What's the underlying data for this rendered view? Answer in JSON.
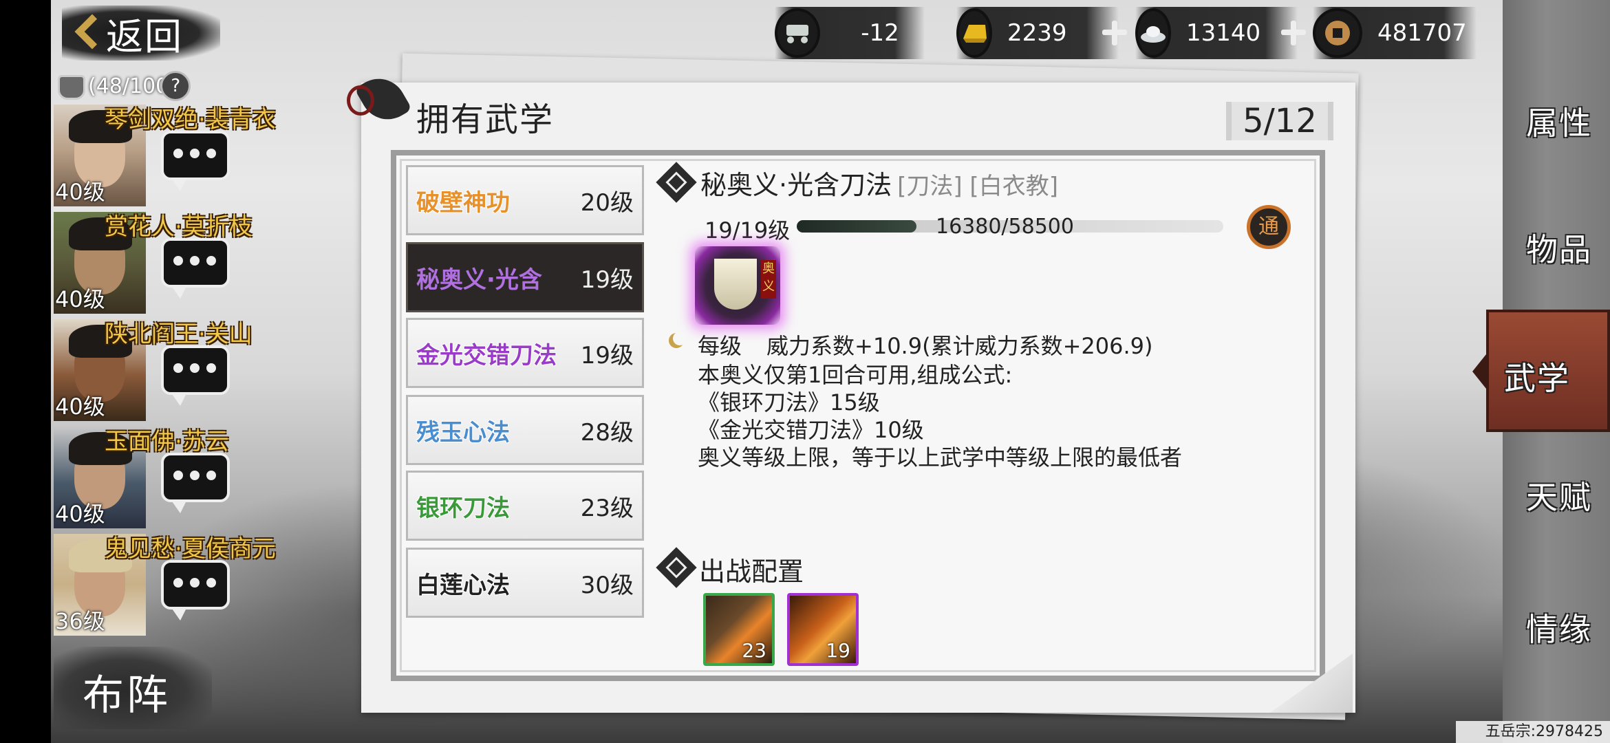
{
  "nav": {
    "back_label": "返回"
  },
  "resources": [
    {
      "name": "cart-icon",
      "value": "-12",
      "plus": false
    },
    {
      "name": "gold-ingot-icon",
      "value": "2239",
      "plus": true
    },
    {
      "name": "silver-ingot-icon",
      "value": "13140",
      "plus": true
    },
    {
      "name": "copper-coin-icon",
      "value": "481707",
      "plus": false
    }
  ],
  "team": {
    "count_text": "(48/100",
    "heroes": [
      {
        "name": "琴剑双绝·裴青衣",
        "level": "40级"
      },
      {
        "name": "赏花人·莫折枝",
        "level": "40级"
      },
      {
        "name": "陕北阎王·关山",
        "level": "40级"
      },
      {
        "name": "玉面佛·苏云",
        "level": "40级"
      },
      {
        "name": "鬼见愁·夏侯商元",
        "level": "36级"
      }
    ],
    "formation_label": "布阵"
  },
  "panel": {
    "title": "拥有武学",
    "page_count": "5/12",
    "skills": [
      {
        "name": "破壁神功",
        "level": "20级",
        "color": "#e8902a"
      },
      {
        "name": "秘奥义·光含",
        "level": "19级",
        "color": "#b070e0"
      },
      {
        "name": "金光交错刀法",
        "level": "19级",
        "color": "#9a3cc8"
      },
      {
        "name": "残玉心法",
        "level": "28级",
        "color": "#4a8ed0"
      },
      {
        "name": "银环刀法",
        "level": "23级",
        "color": "#3a9a3a"
      },
      {
        "name": "白莲心法",
        "level": "30级",
        "color": "#222222"
      }
    ],
    "detail": {
      "title": "秘奥义·光含刀法",
      "tags": "[刀法] [白衣教]",
      "level_text": "19/19级",
      "xp_text": "16380/58500",
      "xp_fraction": 0.28,
      "seal_char": "通",
      "icon_tag": "奥义",
      "per_level_label": "每级",
      "per_level_effect": "威力系数+10.9(累计威力系数+206.9)",
      "desc_lines": [
        "本奥义仅第1回合可用,组成公式:",
        "《银环刀法》15级",
        "《金光交错刀法》10级",
        "奥义等级上限，等于以上武学中等级上限的最低者"
      ],
      "deploy_title": "出战配置",
      "deploy_slots": [
        {
          "level": "23",
          "border": "#3aa84a"
        },
        {
          "level": "19",
          "border": "#a030d0"
        }
      ]
    }
  },
  "right_menu": [
    "属性",
    "物品",
    "武学",
    "天赋",
    "情缘"
  ],
  "footer": "五岳宗:2978425"
}
